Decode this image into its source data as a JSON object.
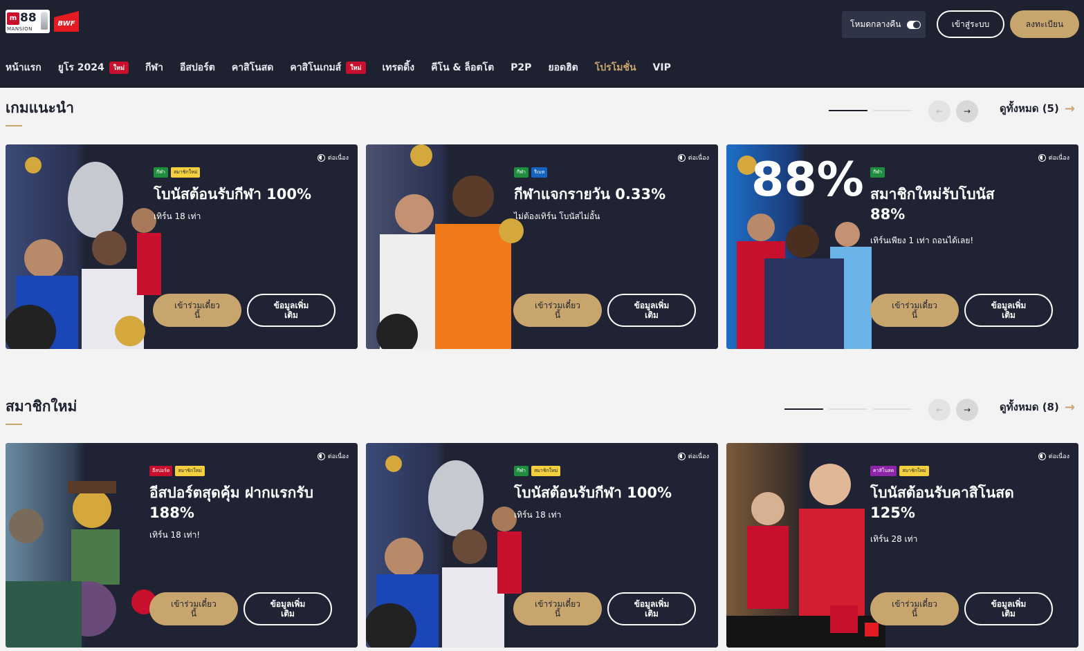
{
  "header": {
    "logo_text": "M88 MANSION",
    "partner_logo": "BWF",
    "dark_mode_label": "โหมดกลางคืน",
    "login_label": "เข้าสู่ระบบ",
    "register_label": "ลงทะเบียน"
  },
  "nav": [
    {
      "label": "หน้าแรก"
    },
    {
      "label": "ยูโร 2024",
      "badge": "ใหม่"
    },
    {
      "label": "กีฬา"
    },
    {
      "label": "อีสปอร์ต"
    },
    {
      "label": "คาสิโนสด"
    },
    {
      "label": "คาสิโนเกมส์",
      "badge": "ใหม่"
    },
    {
      "label": "เทรดดิ้ง"
    },
    {
      "label": "คีโน & ล็อตโต"
    },
    {
      "label": "P2P"
    },
    {
      "label": "ยอดฮิต"
    },
    {
      "label": "โปรโมชั่น",
      "active": true
    },
    {
      "label": "VIP"
    }
  ],
  "sections": [
    {
      "title": "เกมแนะนำ",
      "view_all": "ดูทั้งหมด (5)",
      "cards": [
        {
          "tags": [
            "กีฬา",
            "สมาชิกใหม่"
          ],
          "title": "โบนัสต้อนรับกีฬา 100%",
          "sub": "เทิร์น 18 เท่า",
          "status": "ต่อเนื่อง",
          "join": "เข้าร่วมเดี๋ยวนี้",
          "more": "ข้อมูลเพิ่มเติม"
        },
        {
          "tags": [
            "กีฬา",
            "รีเบท"
          ],
          "title": "กีฬาแจกรายวัน 0.33%",
          "sub": "ไม่ต้องเทิร์น โบนัสไม่อั้น",
          "status": "ต่อเนื่อง",
          "join": "เข้าร่วมเดี๋ยวนี้",
          "more": "ข้อมูลเพิ่มเติม"
        },
        {
          "tags": [
            "กีฬา"
          ],
          "title": "สมาชิกใหม่รับโบนัส 88%",
          "sub": "เทิร์นเพียง 1 เท่า ถอนได้เลย!",
          "status": "ต่อเนื่อง",
          "join": "เข้าร่วมเดี๋ยวนี้",
          "more": "ข้อมูลเพิ่มเติม",
          "big_text": "88%"
        }
      ]
    },
    {
      "title": "สมาชิกใหม่",
      "view_all": "ดูทั้งหมด (8)",
      "cards": [
        {
          "tags": [
            "อีสปอร์ต",
            "สมาชิกใหม่"
          ],
          "title": "อีสปอร์ตสุดคุ้ม ฝากแรกรับ 188%",
          "sub": "เทิร์น 18 เท่า!",
          "status": "ต่อเนื่อง",
          "join": "เข้าร่วมเดี๋ยวนี้",
          "more": "ข้อมูลเพิ่มเติม"
        },
        {
          "tags": [
            "กีฬา",
            "สมาชิกใหม่"
          ],
          "title": "โบนัสต้อนรับกีฬา 100%",
          "sub": "เทิร์น 18 เท่า",
          "status": "ต่อเนื่อง",
          "join": "เข้าร่วมเดี๋ยวนี้",
          "more": "ข้อมูลเพิ่มเติม"
        },
        {
          "tags": [
            "คาสิโนสด",
            "สมาชิกใหม่"
          ],
          "title": "โบนัสต้อนรับคาสิโนสด 125%",
          "sub": "เทิร์น 28 เท่า",
          "status": "ต่อเนื่อง",
          "join": "เข้าร่วมเดี๋ยวนี้",
          "more": "ข้อมูลเพิ่มเติม"
        }
      ]
    }
  ],
  "colors": {
    "accent": "#c9a56e",
    "header_bg": "#1d2130",
    "card_bg": "#1f2333",
    "badge_red": "#c8102e"
  }
}
